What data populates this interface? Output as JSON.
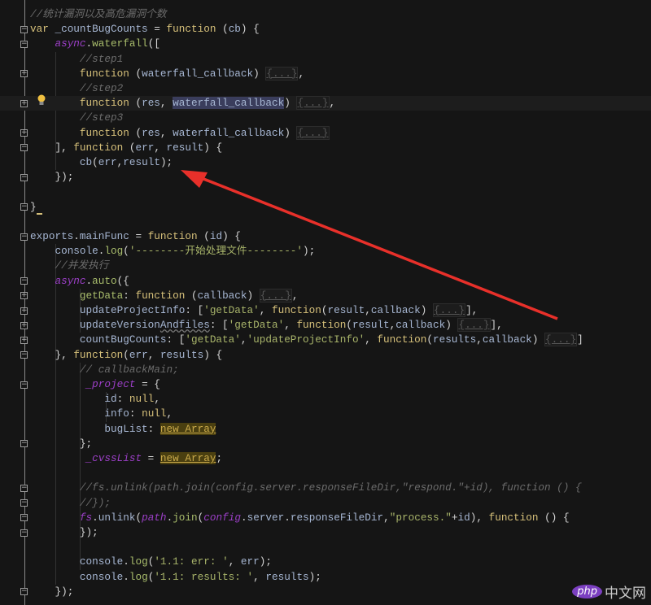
{
  "editor": {
    "lines": [
      [
        [
          "//统计漏洞以及高危漏洞个数",
          "cm"
        ]
      ],
      [
        [
          "var ",
          "kw"
        ],
        [
          "_countBugCounts",
          "id"
        ],
        [
          " = ",
          "pun"
        ],
        [
          "function ",
          "kw"
        ],
        [
          "(",
          "pun"
        ],
        [
          "cb",
          "id"
        ],
        [
          ") {",
          "pun"
        ]
      ],
      [
        [
          "    "
        ],
        [
          "async",
          "gl"
        ],
        [
          ".",
          "pun"
        ],
        [
          "waterfall",
          "fn"
        ],
        [
          "([",
          "pun"
        ]
      ],
      [
        [
          "        "
        ],
        [
          "//step1",
          "cm"
        ]
      ],
      [
        [
          "        "
        ],
        [
          "function ",
          "kw"
        ],
        [
          "(",
          "pun"
        ],
        [
          "waterfall_callback",
          "id"
        ],
        [
          ") ",
          "pun"
        ],
        [
          "{...}",
          "fold"
        ],
        [
          ",",
          "pun"
        ]
      ],
      [
        [
          "        "
        ],
        [
          "//step2",
          "cm"
        ]
      ],
      [
        [
          "        "
        ],
        [
          "function ",
          "kw"
        ],
        [
          "(",
          "pun"
        ],
        [
          "res",
          "id"
        ],
        [
          ", ",
          "pun"
        ],
        [
          "waterfall_callback",
          "sel"
        ],
        [
          ") ",
          "pun"
        ],
        [
          "{...}",
          "fold"
        ],
        [
          ",",
          "pun"
        ]
      ],
      [
        [
          "        "
        ],
        [
          "//step3",
          "cm"
        ]
      ],
      [
        [
          "        "
        ],
        [
          "function ",
          "kw"
        ],
        [
          "(",
          "pun"
        ],
        [
          "res",
          "id"
        ],
        [
          ", ",
          "pun"
        ],
        [
          "waterfall_callback",
          "id"
        ],
        [
          ") ",
          "pun"
        ],
        [
          "{...}",
          "fold"
        ]
      ],
      [
        [
          "    "
        ],
        [
          "], ",
          "pun"
        ],
        [
          "function ",
          "kw"
        ],
        [
          "(",
          "pun"
        ],
        [
          "err",
          "id"
        ],
        [
          ", ",
          "pun"
        ],
        [
          "result",
          "id"
        ],
        [
          ") {",
          "pun"
        ]
      ],
      [
        [
          "        "
        ],
        [
          "cb",
          "id"
        ],
        [
          "(",
          "pun"
        ],
        [
          "err",
          "id"
        ],
        [
          ",",
          "pun"
        ],
        [
          "result",
          "id"
        ],
        [
          ");",
          "pun"
        ]
      ],
      [
        [
          "    "
        ],
        [
          "});",
          "pun"
        ]
      ],
      [],
      [
        [
          "}",
          "pun"
        ]
      ],
      [],
      [
        [
          "exports",
          "id"
        ],
        [
          ".",
          "pun"
        ],
        [
          "mainFunc",
          "id"
        ],
        [
          " = ",
          "pun"
        ],
        [
          "function ",
          "kw"
        ],
        [
          "(",
          "pun"
        ],
        [
          "id",
          "id"
        ],
        [
          ") {",
          "pun"
        ]
      ],
      [
        [
          "    "
        ],
        [
          "console",
          "id"
        ],
        [
          ".",
          "pun"
        ],
        [
          "log",
          "fn"
        ],
        [
          "(",
          "pun"
        ],
        [
          "'--------开始处理文件--------'",
          "str"
        ],
        [
          ");",
          "pun"
        ]
      ],
      [
        [
          "    "
        ],
        [
          "//并发执行",
          "cm"
        ]
      ],
      [
        [
          "    "
        ],
        [
          "async",
          "gl"
        ],
        [
          ".",
          "pun"
        ],
        [
          "auto",
          "fn"
        ],
        [
          "({",
          "pun"
        ]
      ],
      [
        [
          "        "
        ],
        [
          "getData",
          "prop"
        ],
        [
          ": ",
          "pun"
        ],
        [
          "function ",
          "kw"
        ],
        [
          "(",
          "pun"
        ],
        [
          "callback",
          "id"
        ],
        [
          ") ",
          "pun"
        ],
        [
          "{...}",
          "fold"
        ],
        [
          ",",
          "pun"
        ]
      ],
      [
        [
          "        "
        ],
        [
          "updateProjectInfo",
          "id"
        ],
        [
          ": [",
          "pun"
        ],
        [
          "'getData'",
          "str"
        ],
        [
          ", ",
          "pun"
        ],
        [
          "function",
          "kw"
        ],
        [
          "(",
          "pun"
        ],
        [
          "result",
          "id"
        ],
        [
          ",",
          "pun"
        ],
        [
          "callback",
          "id"
        ],
        [
          ") ",
          "pun"
        ],
        [
          "{...}",
          "fold"
        ],
        [
          "],",
          "pun"
        ]
      ],
      [
        [
          "        "
        ],
        [
          "updateVersion",
          "id"
        ],
        [
          "Andfiles",
          "squig id"
        ],
        [
          ": [",
          "pun"
        ],
        [
          "'getData'",
          "str"
        ],
        [
          ", ",
          "pun"
        ],
        [
          "function",
          "kw"
        ],
        [
          "(",
          "pun"
        ],
        [
          "result",
          "id"
        ],
        [
          ",",
          "pun"
        ],
        [
          "callback",
          "id"
        ],
        [
          ") ",
          "pun"
        ],
        [
          "{...}",
          "fold"
        ],
        [
          "],",
          "pun"
        ]
      ],
      [
        [
          "        "
        ],
        [
          "countBugCounts",
          "id"
        ],
        [
          ": [",
          "pun"
        ],
        [
          "'getData'",
          "str"
        ],
        [
          ",",
          "pun"
        ],
        [
          "'updateProjectInfo'",
          "str"
        ],
        [
          ", ",
          "pun"
        ],
        [
          "function",
          "kw"
        ],
        [
          "(",
          "pun"
        ],
        [
          "results",
          "id"
        ],
        [
          ",",
          "pun"
        ],
        [
          "callback",
          "id"
        ],
        [
          ") ",
          "pun"
        ],
        [
          "{...}",
          "fold"
        ],
        [
          "]",
          "pun"
        ]
      ],
      [
        [
          "    "
        ],
        [
          "}, ",
          "pun"
        ],
        [
          "function",
          "kw"
        ],
        [
          "(",
          "pun"
        ],
        [
          "err",
          "id"
        ],
        [
          ", ",
          "pun"
        ],
        [
          "results",
          "id"
        ],
        [
          ") {",
          "pun"
        ]
      ],
      [
        [
          "        "
        ],
        [
          "// callbackMain;",
          "cm"
        ]
      ],
      [
        [
          "         "
        ],
        [
          "_project",
          "gl"
        ],
        [
          " = {",
          "pun"
        ]
      ],
      [
        [
          "            "
        ],
        [
          "id",
          "id"
        ],
        [
          ": ",
          "pun"
        ],
        [
          "null",
          "kw"
        ],
        [
          ",",
          "pun"
        ]
      ],
      [
        [
          "            "
        ],
        [
          "info",
          "id"
        ],
        [
          ": ",
          "pun"
        ],
        [
          "null",
          "kw"
        ],
        [
          ",",
          "pun"
        ]
      ],
      [
        [
          "            "
        ],
        [
          "bugList",
          "id"
        ],
        [
          ": ",
          "pun"
        ],
        [
          "new Array",
          "new"
        ]
      ],
      [
        [
          "        "
        ],
        [
          "};",
          "pun"
        ]
      ],
      [
        [
          "         "
        ],
        [
          "_cvssList",
          "gl"
        ],
        [
          " = ",
          "pun"
        ],
        [
          "new Array",
          "new"
        ],
        [
          ";",
          "pun"
        ]
      ],
      [],
      [
        [
          "        "
        ],
        [
          "//fs.unlink(path.join(config.server.responseFileDir,\"respond.\"+id), function () {",
          "cm"
        ]
      ],
      [
        [
          "        "
        ],
        [
          "//});",
          "cm"
        ]
      ],
      [
        [
          "        "
        ],
        [
          "fs",
          "gl"
        ],
        [
          ".",
          "pun"
        ],
        [
          "unlink",
          "id"
        ],
        [
          "(",
          "pun"
        ],
        [
          "path",
          "gl"
        ],
        [
          ".",
          "pun"
        ],
        [
          "join",
          "fn"
        ],
        [
          "(",
          "pun"
        ],
        [
          "config",
          "gl"
        ],
        [
          ".",
          "pun"
        ],
        [
          "server",
          "id"
        ],
        [
          ".",
          "pun"
        ],
        [
          "responseFileDir",
          "id"
        ],
        [
          ",",
          "pun"
        ],
        [
          "\"process.\"",
          "str"
        ],
        [
          "+",
          "pun"
        ],
        [
          "id",
          "id"
        ],
        [
          "), ",
          "pun"
        ],
        [
          "function ",
          "kw"
        ],
        [
          "() {",
          "pun"
        ]
      ],
      [
        [
          "        "
        ],
        [
          "});",
          "pun"
        ]
      ],
      [],
      [
        [
          "        "
        ],
        [
          "console",
          "id"
        ],
        [
          ".",
          "pun"
        ],
        [
          "log",
          "fn"
        ],
        [
          "(",
          "pun"
        ],
        [
          "'1.1: err: '",
          "str"
        ],
        [
          ", ",
          "pun"
        ],
        [
          "err",
          "id"
        ],
        [
          ");",
          "pun"
        ]
      ],
      [
        [
          "        "
        ],
        [
          "console",
          "id"
        ],
        [
          ".",
          "pun"
        ],
        [
          "log",
          "fn"
        ],
        [
          "(",
          "pun"
        ],
        [
          "'1.1: results: '",
          "str"
        ],
        [
          ", ",
          "pun"
        ],
        [
          "results",
          "id"
        ],
        [
          ");",
          "pun"
        ]
      ],
      [
        [
          "    "
        ],
        [
          "});",
          "pun"
        ]
      ]
    ],
    "fold_minus_lines": [
      1,
      2,
      9,
      11,
      13,
      15,
      18,
      23,
      25,
      29,
      32,
      33,
      34,
      35,
      39
    ],
    "fold_plus_lines": [
      4,
      6,
      8,
      19,
      20,
      21,
      22
    ],
    "highlighted_line": 6,
    "cursor_line": 13
  },
  "annotation": {
    "arrow_color": "#e8302a"
  },
  "watermark": {
    "badge": "php",
    "text": "中文网"
  }
}
